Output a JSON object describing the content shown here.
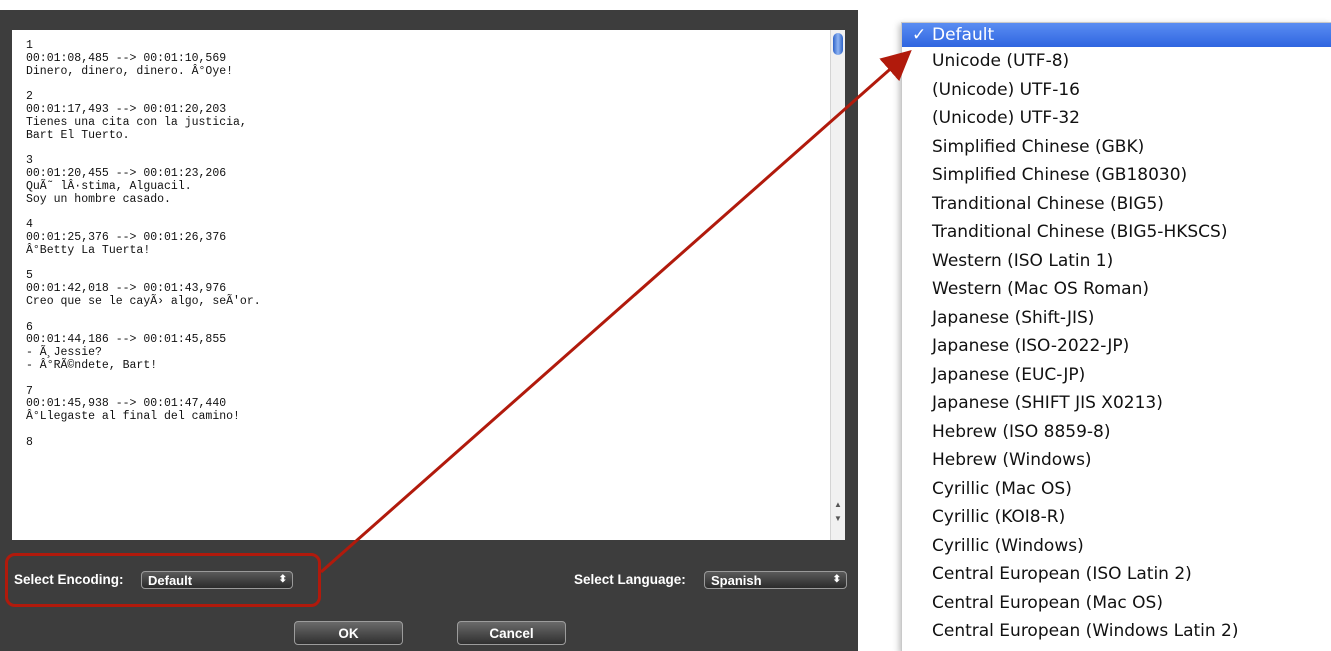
{
  "subtitle_text": "1\n00:01:08,485 --> 00:01:10,569\nDinero, dinero, dinero. Â°Oye!\n\n2\n00:01:17,493 --> 00:01:20,203\nTienes una cita con la justicia,\nBart El Tuerto.\n\n3\n00:01:20,455 --> 00:01:23,206\nQuÃ˜ lÂ·stima, Alguacil.\nSoy un hombre casado.\n\n4\n00:01:25,376 --> 00:01:26,376\nÂ°Betty La Tuerta!\n\n5\n00:01:42,018 --> 00:01:43,976\nCreo que se le cayÃ› algo, seÃ'or.\n\n6\n00:01:44,186 --> 00:01:45,855\n- Ã¸Jessie?\n- Â°RÃ©ndete, Bart!\n\n7\n00:01:45,938 --> 00:01:47,440\nÂ°Llegaste al final del camino!\n\n8",
  "encoding": {
    "label": "Select Encoding:",
    "value": "Default",
    "arrows": "⬍"
  },
  "language": {
    "label": "Select Language:",
    "value": "Spanish",
    "arrows": "⬍"
  },
  "buttons": {
    "ok": "OK",
    "cancel": "Cancel"
  },
  "encoding_menu": {
    "check": "✓",
    "items": [
      "Default",
      "Unicode  (UTF-8)",
      "(Unicode) UTF-16",
      "(Unicode) UTF-32",
      "Simplified Chinese  (GBK)",
      "Simplified Chinese  (GB18030)",
      "Tranditional Chinese  (BIG5)",
      "Tranditional Chinese  (BIG5-HKSCS)",
      "Western  (ISO Latin 1)",
      "Western  (Mac OS Roman)",
      "Japanese  (Shift-JIS)",
      "Japanese  (ISO-2022-JP)",
      "Japanese  (EUC-JP)",
      "Japanese  (SHIFT JIS X0213)",
      "Hebrew  (ISO 8859-8)",
      "Hebrew  (Windows)",
      "Cyrillic  (Mac OS)",
      "Cyrillic  (KOI8-R)",
      "Cyrillic  (Windows)",
      "Central European  (ISO Latin 2)",
      "Central European  (Mac OS)",
      "Central European  (Windows Latin 2)"
    ]
  },
  "colors": {
    "dialog_bg": "#3d3d3d",
    "highlight": "#b11a0c",
    "menu_selected": "#3a6fe6"
  }
}
